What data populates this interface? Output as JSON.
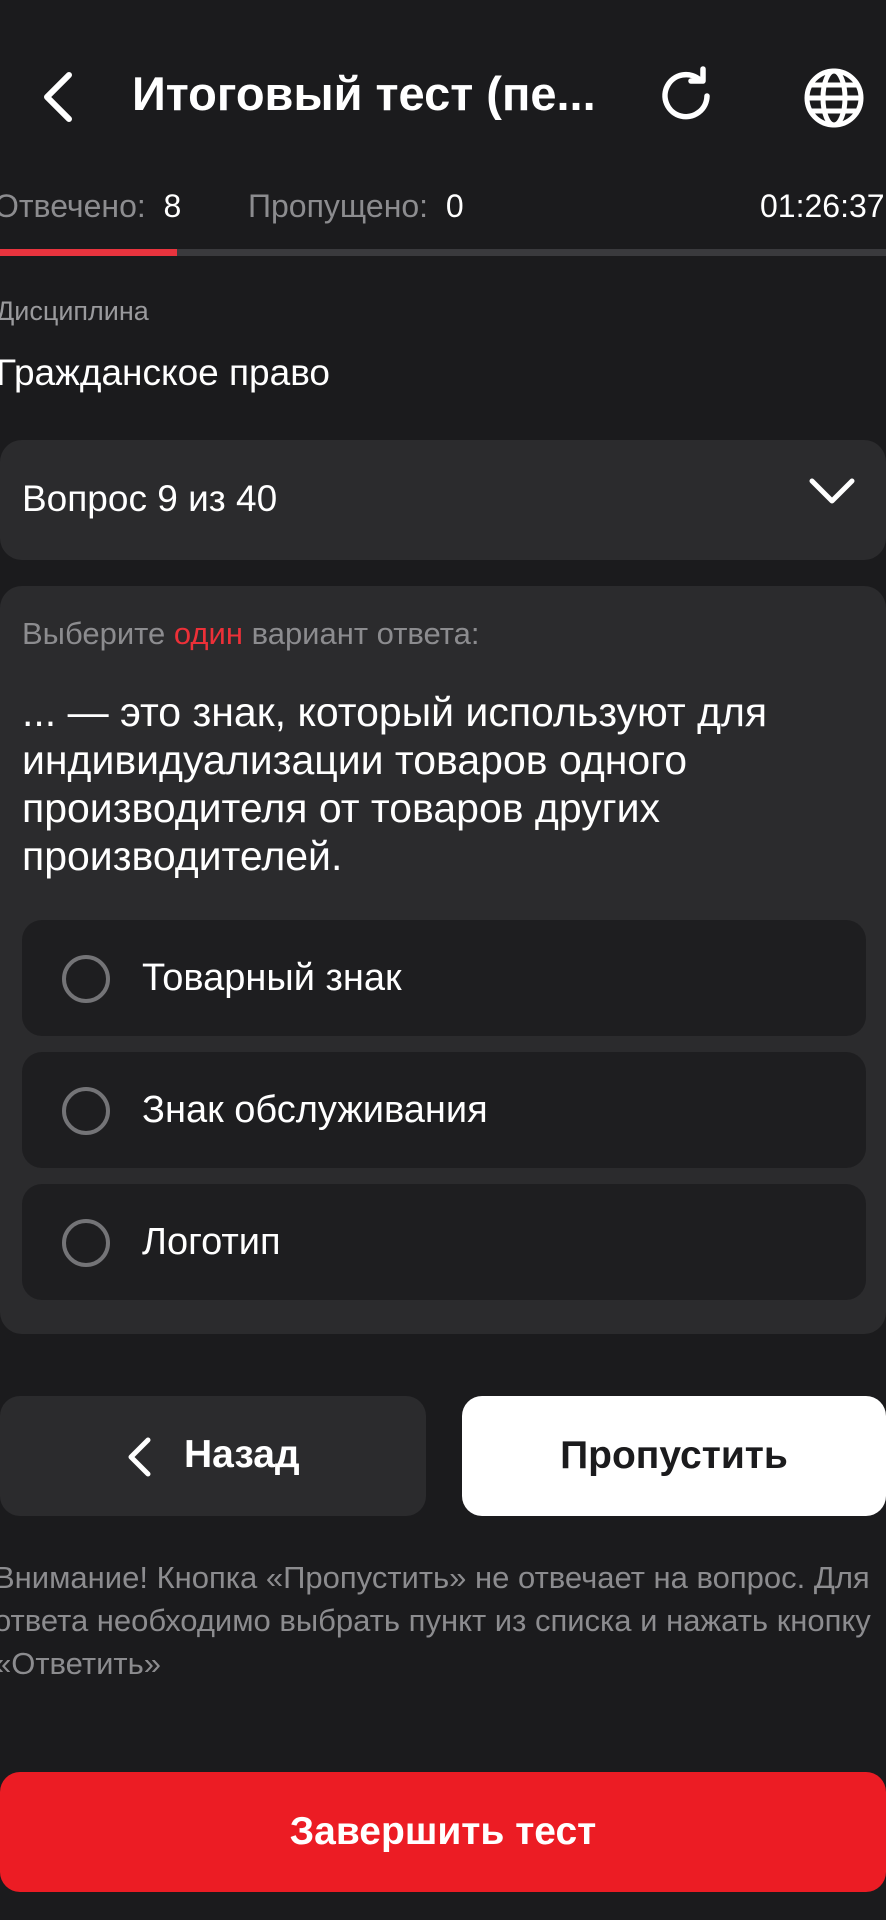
{
  "header": {
    "title": "Итоговый тест (пе...",
    "back_icon": "chevron-left-icon",
    "refresh_icon": "refresh-icon",
    "globe_icon": "globe-icon"
  },
  "stats": {
    "answered_label": "Отвечено:",
    "answered_value": "8",
    "skipped_label": "Пропущено:",
    "skipped_value": "0",
    "timer": "01:26:37",
    "progress": 0.2
  },
  "discipline": {
    "label": "Дисциплина",
    "value": "Гражданское право"
  },
  "question_selector": {
    "label": "Вопрос 9 из 40"
  },
  "question": {
    "hint_before": "Выберите ",
    "hint_accent": "один",
    "hint_after": " вариант ответа:",
    "text": "...  — это знак, который используют для индивидуализации товаров одного производителя от товаров других производителей.",
    "options": [
      {
        "label": "Товарный знак"
      },
      {
        "label": "Знак обслуживания"
      },
      {
        "label": "Логотип"
      }
    ]
  },
  "actions": {
    "back_label": "Назад",
    "skip_label": "Пропустить",
    "warning": "Внимание! Кнопка «Пропустить» не отвечает на вопрос. Для ответа необходимо выбрать пункт из списка и нажать кнопку «Ответить»",
    "finish_label": "Завершить тест"
  },
  "colors": {
    "background": "#1b1b1d",
    "card": "#2b2b2d",
    "accent": "#ec1c24",
    "progress": "#e8343e"
  }
}
